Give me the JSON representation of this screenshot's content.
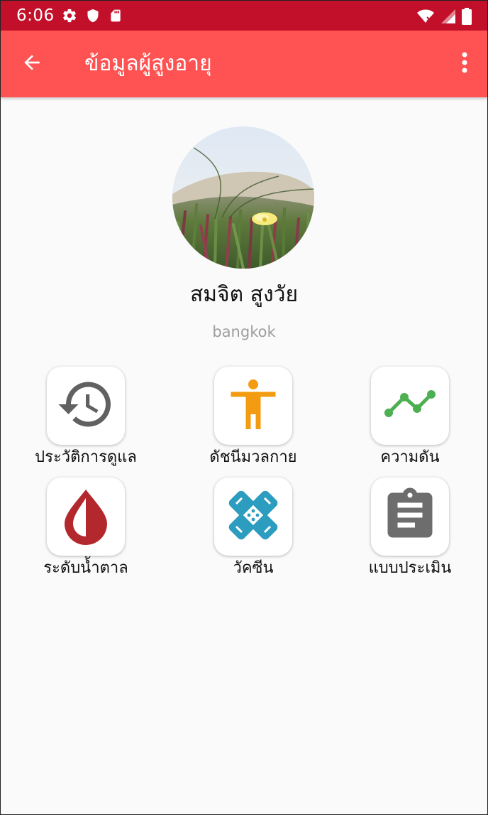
{
  "status_bar": {
    "time": "6:06",
    "icons": [
      "gear-icon",
      "shield-icon",
      "sd-card-icon",
      "wifi-icon",
      "signal-icon",
      "battery-icon"
    ]
  },
  "app_bar": {
    "title": "ข้อมูลผู้สูงอายุ",
    "back_icon": "arrow-back-icon",
    "overflow_icon": "more-vert-icon"
  },
  "profile": {
    "name": "สมจิต สูงวัย",
    "location": "bangkok"
  },
  "menu": {
    "items": [
      {
        "label": "ประวัติการดูแล",
        "icon": "history-icon",
        "color": "#616161"
      },
      {
        "label": "ดัชนีมวลกาย",
        "icon": "person-icon",
        "color": "#f39c12"
      },
      {
        "label": "ความดัน",
        "icon": "trend-line-icon",
        "color": "#4caf50"
      },
      {
        "label": "ระดับน้ำตาล",
        "icon": "blood-drop-icon",
        "color": "#b3282d"
      },
      {
        "label": "วัคซีน",
        "icon": "bandage-icon",
        "color": "#2c9cbf"
      },
      {
        "label": "แบบประเมิน",
        "icon": "clipboard-icon",
        "color": "#6d6d6d"
      }
    ]
  },
  "colors": {
    "status_bar": "#c2102a",
    "app_bar": "#ff5252",
    "background": "#fafafa"
  }
}
